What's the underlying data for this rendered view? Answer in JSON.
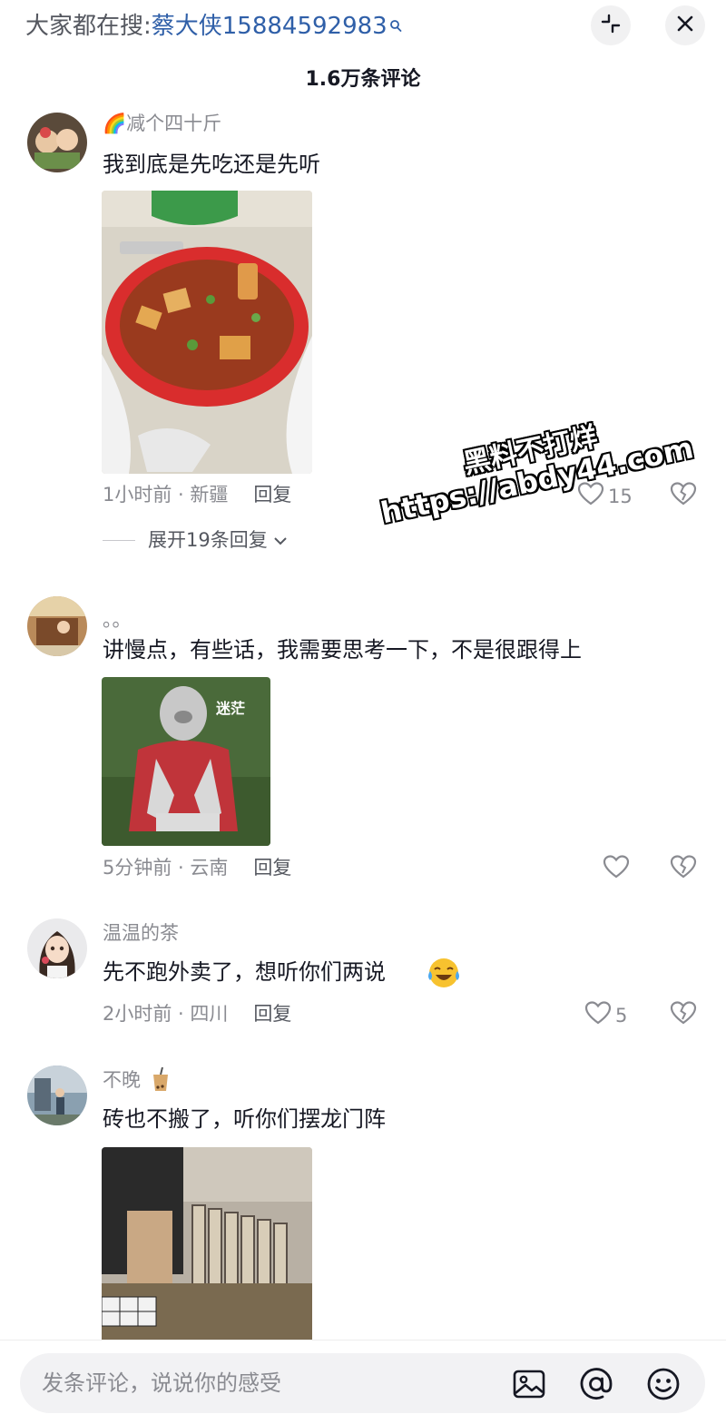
{
  "search": {
    "prefix": "大家都在搜:",
    "query": "蔡大侠15884592983"
  },
  "header": {
    "comment_count": "1.6万条评论"
  },
  "comments": [
    {
      "username": "🌈减个四十斤",
      "text": "我到底是先吃还是先听",
      "time_location": "1小时前 · 新疆",
      "reply_label": "回复",
      "likes": "15",
      "expand_label": "展开19条回复"
    },
    {
      "username": "。。",
      "text": "讲慢点，有些话，我需要思考一下，不是很跟得上",
      "image_caption": "迷茫",
      "time_location": "5分钟前 · 云南",
      "reply_label": "回复",
      "likes": ""
    },
    {
      "username": "温温的茶",
      "text": "先不跑外卖了，想听你们两说",
      "time_location": "2小时前 · 四川",
      "reply_label": "回复",
      "likes": "5"
    },
    {
      "username": "不晚",
      "text": "砖也不搬了，听你们摆龙门阵"
    }
  ],
  "watermark": {
    "line1": "黑料不打烊",
    "line2": "https://abdy44.com"
  },
  "input": {
    "placeholder": "发条评论，说说你的感受"
  },
  "colors": {
    "accent_link": "#2f5fa8",
    "secondary_text": "#8a8b91"
  }
}
